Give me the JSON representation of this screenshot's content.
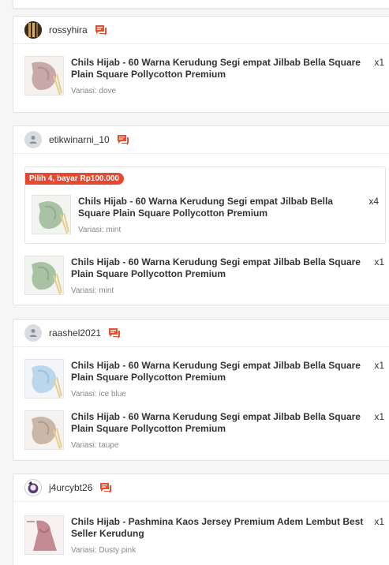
{
  "orders": [
    {
      "username": "rossyhira",
      "items": [
        {
          "name": "Chils Hijab - 60 Warna Kerudung Segi empat Jilbab Bella Square Plain Square Pollycotton Premium",
          "qty": "x1",
          "variant": "Variasi: dove",
          "thumb_color": "#c9a8aa"
        }
      ]
    },
    {
      "username": "etikwinarni_10",
      "bundle": {
        "badge": "Pilih 4, bayar Rp100.000",
        "items": [
          {
            "name": "Chils Hijab - 60 Warna Kerudung Segi empat Jilbab Bella Square Plain Square Pollycotton Premium",
            "qty": "x4",
            "variant": "Variasi: mint",
            "thumb_color": "#a9c2a4"
          }
        ]
      },
      "items": [
        {
          "name": "Chils Hijab - 60 Warna Kerudung Segi empat Jilbab Bella Square Plain Square Pollycotton Premium",
          "qty": "x1",
          "variant": "Variasi: mint",
          "thumb_color": "#a9c2a4"
        }
      ]
    },
    {
      "username": "raashel2021",
      "items": [
        {
          "name": "Chils Hijab - 60 Warna Kerudung Segi empat Jilbab Bella Square Plain Square Pollycotton Premium",
          "qty": "x1",
          "variant": "Variasi: ice blue",
          "thumb_color": "#bcd6ee"
        },
        {
          "name": "Chils Hijab - 60 Warna Kerudung Segi empat Jilbab Bella Square Plain Square Pollycotton Premium",
          "qty": "x1",
          "variant": "Variasi: taupe",
          "thumb_color": "#cbb7a8"
        }
      ]
    },
    {
      "username": "j4urcybt26",
      "items": [
        {
          "name": "Chils Hijab - Pashmina Kaos Jersey Premium Adem Lembut Best Seller Kerudung",
          "qty": "x1",
          "variant": "Variasi: Dusty pink",
          "thumb_color": "#c48b92"
        }
      ]
    }
  ],
  "colors": {
    "chat_icon": "#ee4d2d",
    "badge": "#e8472f"
  },
  "icons": {
    "chat": "chat-icon",
    "default_avatar": "user-icon"
  }
}
